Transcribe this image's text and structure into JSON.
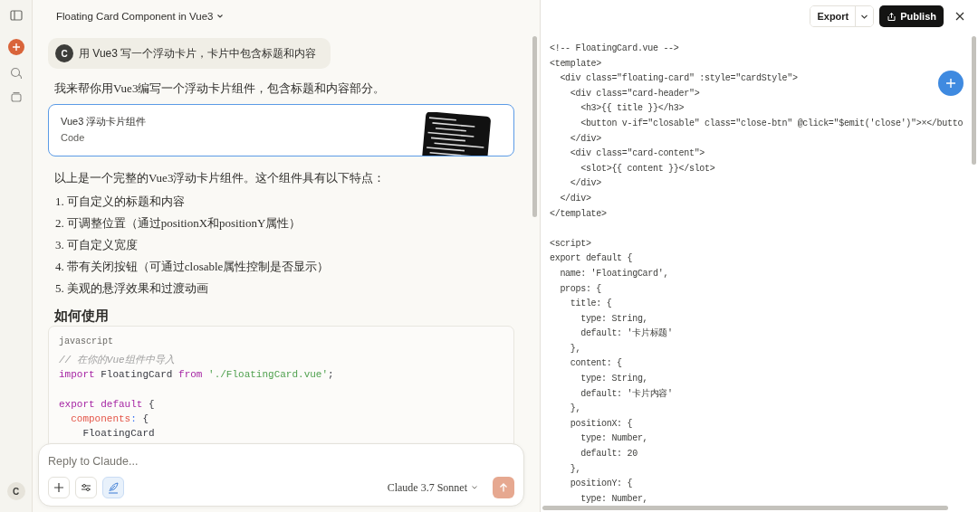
{
  "sidebar": {
    "avatar": "C"
  },
  "chat": {
    "title": "Floating Card Component in Vue3",
    "user_message": {
      "avatar": "C",
      "text": "用 Vue3 写一个浮动卡片，卡片中包含标题和内容"
    },
    "reply_intro": "我来帮你用Vue3编写一个浮动卡片组件，包含标题和内容部分。",
    "artifact": {
      "title": "Vue3 浮动卡片组件",
      "type": "Code"
    },
    "summary": "以上是一个完整的Vue3浮动卡片组件。这个组件具有以下特点：",
    "features": [
      {
        "number": "1.",
        "text": "可自定义的标题和内容"
      },
      {
        "number": "2.",
        "text": "可调整位置（通过positionX和positionY属性）"
      },
      {
        "number": "3.",
        "text": "可自定义宽度"
      },
      {
        "number": "4.",
        "text": "带有关闭按钮（可通过closable属性控制是否显示）"
      },
      {
        "number": "5.",
        "text": "美观的悬浮效果和过渡动画"
      }
    ],
    "heading": "如何使用",
    "code_block": {
      "language": "javascript",
      "lines": [
        {
          "kind": "code",
          "tokens": [
            {
              "kind": "comment",
              "text": "// 在你的Vue组件中导入"
            }
          ]
        },
        {
          "kind": "code",
          "tokens": [
            {
              "kind": "keyword",
              "text": "import"
            },
            {
              "kind": "plain",
              "text": " FloatingCard "
            },
            {
              "kind": "keyword",
              "text": "from"
            },
            {
              "kind": "string",
              "text": " './FloatingCard.vue'"
            },
            {
              "kind": "plain",
              "text": ";"
            }
          ]
        },
        {
          "kind": "blank"
        },
        {
          "kind": "code",
          "tokens": [
            {
              "kind": "keyword",
              "text": "export default"
            },
            {
              "kind": "plain",
              "text": " {"
            }
          ]
        },
        {
          "kind": "code",
          "tokens": [
            {
              "kind": "property",
              "text": "  components"
            },
            {
              "kind": "punct",
              "text": ":"
            },
            {
              "kind": "plain",
              "text": " {"
            }
          ]
        },
        {
          "kind": "code",
          "tokens": [
            {
              "kind": "plain",
              "text": "    FloatingCard"
            }
          ]
        }
      ]
    }
  },
  "composer": {
    "placeholder": "Reply to Claude...",
    "tools": [
      {
        "kind": "add",
        "selected": false
      },
      {
        "kind": "settings",
        "selected": false
      },
      {
        "kind": "style",
        "selected": true
      }
    ],
    "model": "Claude 3.7 Sonnet"
  },
  "artifact_panel": {
    "export": "Export",
    "publish": "Publish",
    "code_lines": [
      {
        "kind": "code",
        "text": "<!-- FloatingCard.vue -->"
      },
      {
        "kind": "code",
        "text": "<template>"
      },
      {
        "kind": "code",
        "text": "  <div class=\"floating-card\" :style=\"cardStyle\">"
      },
      {
        "kind": "code",
        "text": "    <div class=\"card-header\">"
      },
      {
        "kind": "code",
        "text": "      <h3>{{ title }}</h3>"
      },
      {
        "kind": "code",
        "text": "      <button v-if=\"closable\" class=\"close-btn\" @click=\"$emit('close')\">×</butto"
      },
      {
        "kind": "code",
        "text": "    </div>"
      },
      {
        "kind": "code",
        "text": "    <div class=\"card-content\">"
      },
      {
        "kind": "code",
        "text": "      <slot>{{ content }}</slot>"
      },
      {
        "kind": "code",
        "text": "    </div>"
      },
      {
        "kind": "code",
        "text": "  </div>"
      },
      {
        "kind": "code",
        "text": "</template>"
      },
      {
        "kind": "blank"
      },
      {
        "kind": "code",
        "text": "<script>"
      },
      {
        "kind": "code",
        "text": "export default {"
      },
      {
        "kind": "code",
        "text": "  name: 'FloatingCard',"
      },
      {
        "kind": "code",
        "text": "  props: {"
      },
      {
        "kind": "code",
        "text": "    title: {"
      },
      {
        "kind": "code",
        "text": "      type: String,"
      },
      {
        "kind": "code",
        "text": "      default: '卡片标题'"
      },
      {
        "kind": "code",
        "text": "    },"
      },
      {
        "kind": "code",
        "text": "    content: {"
      },
      {
        "kind": "code",
        "text": "      type: String,"
      },
      {
        "kind": "code",
        "text": "      default: '卡片内容'"
      },
      {
        "kind": "code",
        "text": "    },"
      },
      {
        "kind": "code",
        "text": "    positionX: {"
      },
      {
        "kind": "code",
        "text": "      type: Number,"
      },
      {
        "kind": "code",
        "text": "      default: 20"
      },
      {
        "kind": "code",
        "text": "    },"
      },
      {
        "kind": "code",
        "text": "    positionY: {"
      },
      {
        "kind": "code",
        "text": "      type: Number,"
      }
    ]
  }
}
